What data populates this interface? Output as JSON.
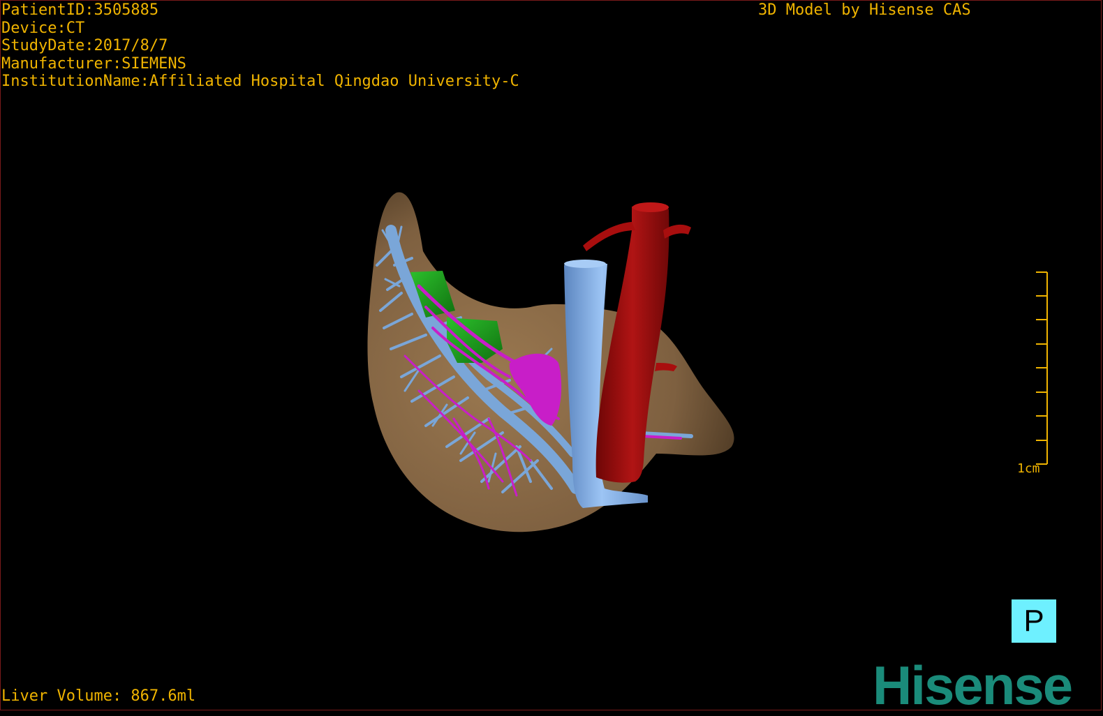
{
  "header": {
    "patient_id": "PatientID:3505885",
    "device": "Device:CT",
    "study_date": "StudyDate:2017/8/7",
    "manufacturer": "Manufacturer:SIEMENS",
    "institution": "InstitutionName:Affiliated Hospital Qingdao University-C",
    "credit": "3D Model by Hisense CAS"
  },
  "footer": {
    "liver_volume": "Liver Volume: 867.6ml"
  },
  "scale_bar": {
    "label": "1cm",
    "tick_count": 9
  },
  "orientation_marker": {
    "label": "P"
  },
  "logo": {
    "text": "Hisense"
  },
  "colors": {
    "overlay_text": "#f0b400",
    "liver": "#8a6a45",
    "portal_vein": "#7aa6d8",
    "hepatic_artery": "#c81ec8",
    "tumor": "#1ea01e",
    "vena_cava": "#8fb8ee",
    "aorta": "#a80e0e",
    "orientation_bg": "#6ef0ff",
    "logo": "#1a8b7a"
  }
}
